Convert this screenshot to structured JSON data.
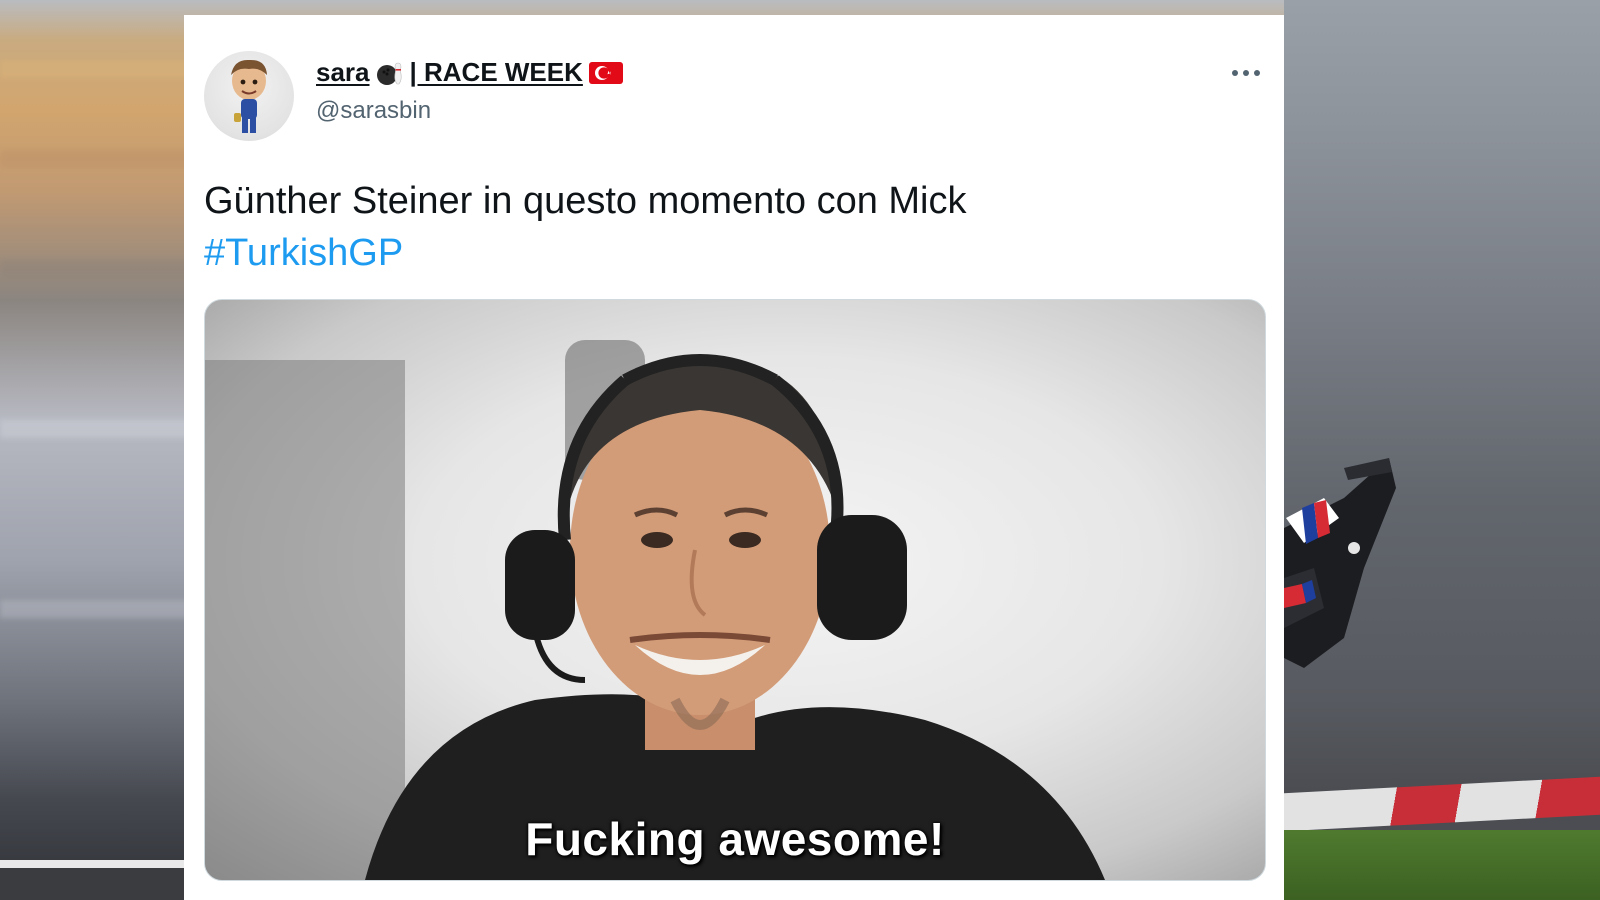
{
  "tweet": {
    "display_name": "sara",
    "name_suffix": "| RACE WEEK",
    "handle": "@sarasbin",
    "text": "Günther Steiner in questo momento con Mick",
    "hashtag": "#TurkishGP",
    "media": {
      "caption": "Fucking awesome!",
      "subject": "man-with-headset"
    }
  },
  "icons": {
    "more": "more-dots-icon",
    "bowling": "bowling-emoji-icon",
    "flag": "turkey-flag-icon"
  },
  "colors": {
    "hashtag": "#1d9bf0",
    "text": "#0f1419",
    "handle": "#536471",
    "card": "#ffffff",
    "flag_red": "#e30a17"
  }
}
